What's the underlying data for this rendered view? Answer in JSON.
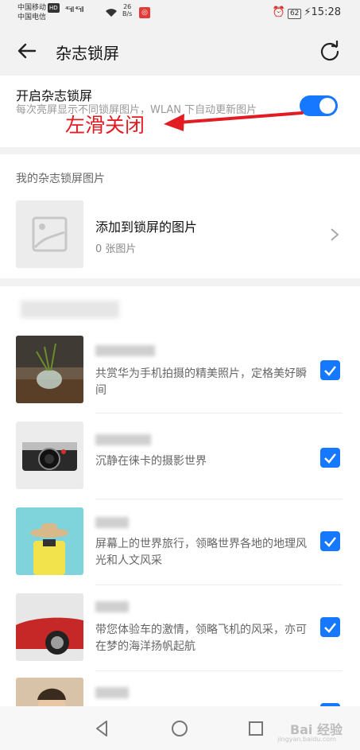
{
  "status_bar": {
    "carrier1": "中国移动",
    "carrier2": "中国电信",
    "hd": "HD",
    "signal": "⁴ᴳıll ⁴ᴳıll",
    "speed_value": "26",
    "speed_unit": "B/s",
    "battery": "62",
    "time": "15:28"
  },
  "appbar": {
    "title": "杂志锁屏",
    "back_icon": "back-arrow-icon",
    "refresh_icon": "refresh-icon"
  },
  "toggle_card": {
    "title": "开启杂志锁屏",
    "description": "每次亮屏显示不同锁屏图片，WLAN 下自动更新图片",
    "enabled": true,
    "accent": "#1677ff"
  },
  "annotation": {
    "text": "左滑关闭",
    "color": "#e31c23"
  },
  "my_pictures": {
    "section_label": "我的杂志锁屏图片",
    "add_title": "添加到锁屏的图片",
    "add_count": "0 张图片"
  },
  "channels": [
    {
      "description": "共赏华为手机拍摄的精美照片，定格美好瞬间",
      "checked": true
    },
    {
      "description": "沉静在徕卡的摄影世界",
      "checked": true
    },
    {
      "description": "屏幕上的世界旅行，领略世界各地的地理风光和人文风采",
      "checked": true
    },
    {
      "description": "带您体验车的激情，领略飞机的风采，亦可在梦的海洋扬帆起航",
      "checked": true
    },
    {
      "description": "",
      "checked": true
    }
  ],
  "watermark": {
    "text": "Bai 经验",
    "sub": "jingyan.baidu.com"
  }
}
